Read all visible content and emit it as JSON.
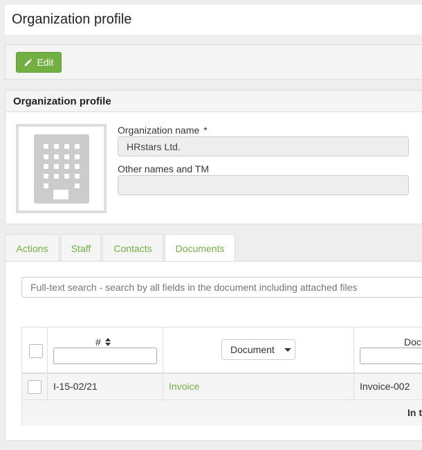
{
  "page": {
    "title": "Organization profile"
  },
  "toolbar": {
    "edit_label": "Edit"
  },
  "profile": {
    "heading": "Organization profile",
    "org_name_label": "Organization name",
    "required_mark": "*",
    "org_name_value": "HRstars Ltd.",
    "other_names_label": "Other names and TM",
    "other_names_value": ""
  },
  "tabs": [
    {
      "label": "Actions",
      "active": false
    },
    {
      "label": "Staff",
      "active": false
    },
    {
      "label": "Contacts",
      "active": false
    },
    {
      "label": "Documents",
      "active": true
    }
  ],
  "documents": {
    "search_placeholder": "Full-text search - search by all fields in the document including attached files",
    "columns": {
      "number_label": "#",
      "document_type_label": "Document",
      "document_label_partial": "Docu"
    },
    "rows": [
      {
        "number": "I-15-02/21",
        "type": "Invoice",
        "document": "Invoice-002"
      }
    ],
    "total_label_partial": "In t"
  },
  "colors": {
    "accent": "#72b043",
    "border": "#dddddd",
    "panel_bg": "#f5f5f5"
  },
  "icons": {
    "edit": "pencil-icon",
    "sort": "sort-icon",
    "logo": "building-icon"
  }
}
